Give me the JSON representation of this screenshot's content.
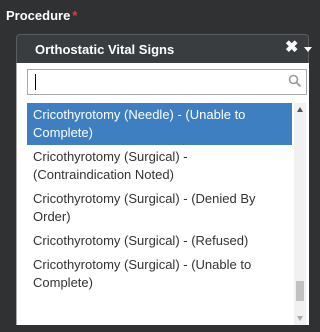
{
  "field": {
    "label": "Procedure",
    "required_marker": "*"
  },
  "select": {
    "value": "Orthostatic Vital Signs",
    "clear_symbol": "✖"
  },
  "search": {
    "placeholder": "",
    "value": ""
  },
  "options": [
    {
      "label": "Cricothyrotomy (Needle) - (Unable to Complete)",
      "selected": true
    },
    {
      "label": "Cricothyrotomy (Surgical) - (Contraindication Noted)",
      "selected": false
    },
    {
      "label": "Cricothyrotomy (Surgical) - (Denied By Order)",
      "selected": false
    },
    {
      "label": "Cricothyrotomy (Surgical) - (Refused)",
      "selected": false
    },
    {
      "label": "Cricothyrotomy (Surgical) - (Unable to Complete)",
      "selected": false
    }
  ],
  "colors": {
    "background": "#2f3133",
    "highlight": "#3e7fc1",
    "required": "#e23b3b"
  }
}
